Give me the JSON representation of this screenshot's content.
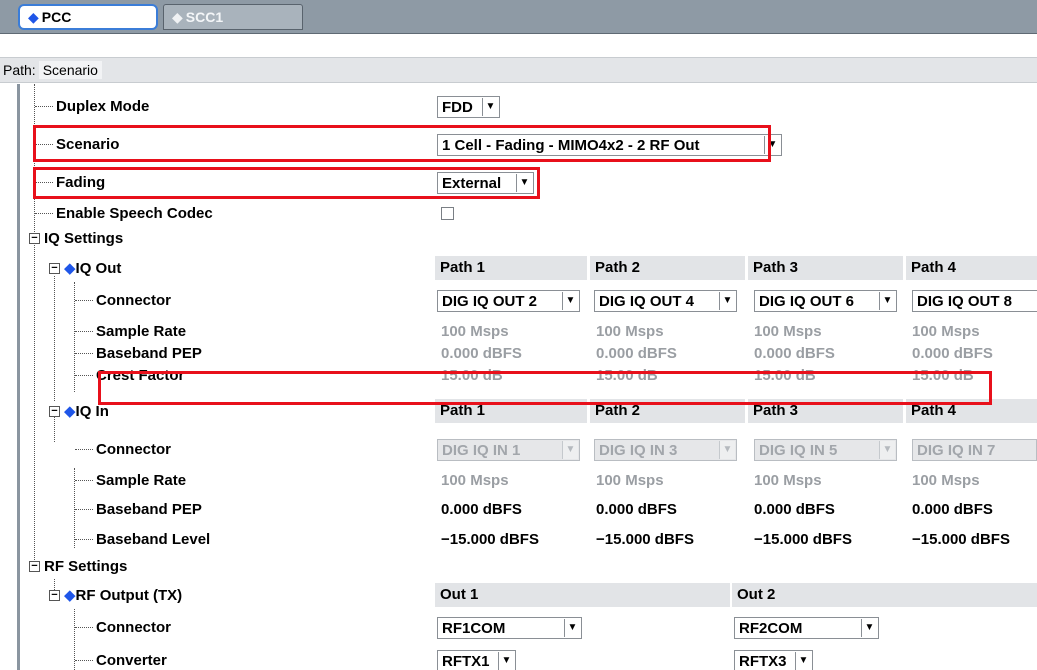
{
  "tabs": [
    {
      "label": "PCC",
      "active": true
    },
    {
      "label": "SCC1",
      "active": false
    }
  ],
  "path": {
    "label": "Path:",
    "value": "Scenario"
  },
  "rows": {
    "duplex_mode": {
      "label": "Duplex Mode",
      "value": "FDD"
    },
    "scenario": {
      "label": "Scenario",
      "value": "1 Cell - Fading - MIMO4x2 - 2 RF Out"
    },
    "fading": {
      "label": "Fading",
      "value": "External"
    },
    "speech_codec": {
      "label": "Enable Speech Codec",
      "checked": false
    },
    "iq_settings": {
      "label": "IQ Settings"
    },
    "iq_out": {
      "label": "IQ Out",
      "paths": [
        "Path 1",
        "Path 2",
        "Path 3",
        "Path 4"
      ],
      "connector": {
        "label": "Connector",
        "values": [
          "DIG IQ OUT 2",
          "DIG IQ OUT 4",
          "DIG IQ OUT 6",
          "DIG IQ OUT 8"
        ]
      },
      "sample_rate": {
        "label": "Sample Rate",
        "values": [
          "100 Msps",
          "100 Msps",
          "100 Msps",
          "100 Msps"
        ]
      },
      "baseband_pep": {
        "label": "Baseband PEP",
        "values": [
          "0.000 dBFS",
          "0.000 dBFS",
          "0.000 dBFS",
          "0.000 dBFS"
        ]
      },
      "crest_factor": {
        "label": "Crest Factor",
        "values": [
          "15.00 dB",
          "15.00 dB",
          "15.00 dB",
          "15.00 dB"
        ]
      }
    },
    "iq_in": {
      "label": "IQ In",
      "paths": [
        "Path 1",
        "Path 2",
        "Path 3",
        "Path 4"
      ],
      "connector": {
        "label": "Connector",
        "values": [
          "DIG IQ IN 1",
          "DIG IQ IN 3",
          "DIG IQ IN 5",
          "DIG IQ IN 7"
        ]
      },
      "sample_rate": {
        "label": "Sample Rate",
        "values": [
          "100 Msps",
          "100 Msps",
          "100 Msps",
          "100 Msps"
        ]
      },
      "baseband_pep": {
        "label": "Baseband PEP",
        "values": [
          "0.000 dBFS",
          "0.000 dBFS",
          "0.000 dBFS",
          "0.000 dBFS"
        ]
      },
      "baseband_level": {
        "label": "Baseband Level",
        "values": [
          "−15.000 dBFS",
          "−15.000 dBFS",
          "−15.000 dBFS",
          "−15.000 dBFS"
        ]
      }
    },
    "rf_settings": {
      "label": "RF Settings"
    },
    "rf_output": {
      "label": "RF Output (TX)",
      "outs": [
        "Out 1",
        "Out 2"
      ],
      "connector": {
        "label": "Connector",
        "values": [
          "RF1COM",
          "RF2COM"
        ]
      },
      "converter": {
        "label": "Converter",
        "values": [
          "RFTX1",
          "RFTX3"
        ]
      }
    }
  },
  "colors": {
    "highlight": "#e8101b",
    "accent": "#1f56e8"
  }
}
